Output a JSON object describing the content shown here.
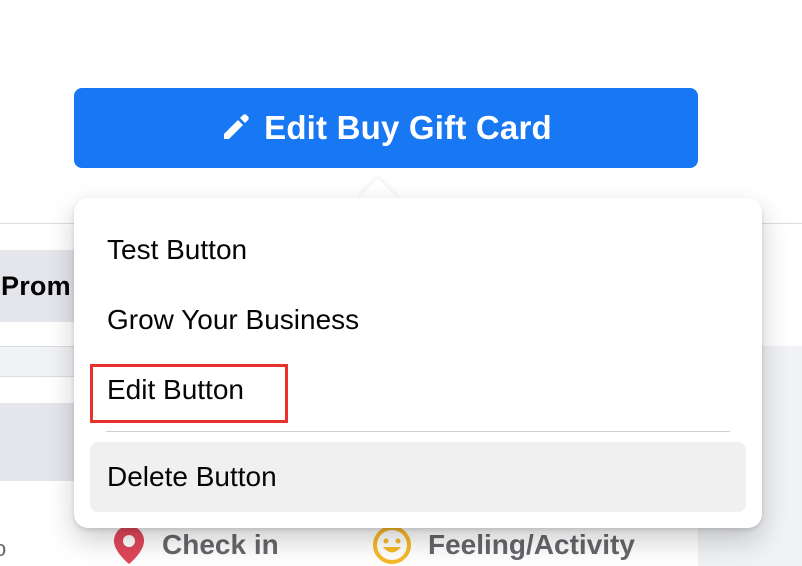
{
  "background": {
    "prom_label": "Prom",
    "actions": [
      {
        "label": "Check in",
        "icon": "location-pin-icon",
        "color": "#e0475b"
      },
      {
        "label": "Feeling/Activity",
        "icon": "smiley-icon",
        "color": "#f7b928"
      }
    ]
  },
  "main_button": {
    "label": "Edit Buy Gift Card",
    "icon": "pencil-icon",
    "color": "#1877f2"
  },
  "menu": {
    "items": [
      {
        "label": "Test Button"
      },
      {
        "label": "Grow Your Business"
      },
      {
        "label": "Edit Button",
        "highlighted": true
      },
      {
        "label": "Delete Button",
        "hovered": true
      }
    ],
    "highlight_color": "#e8322b"
  }
}
